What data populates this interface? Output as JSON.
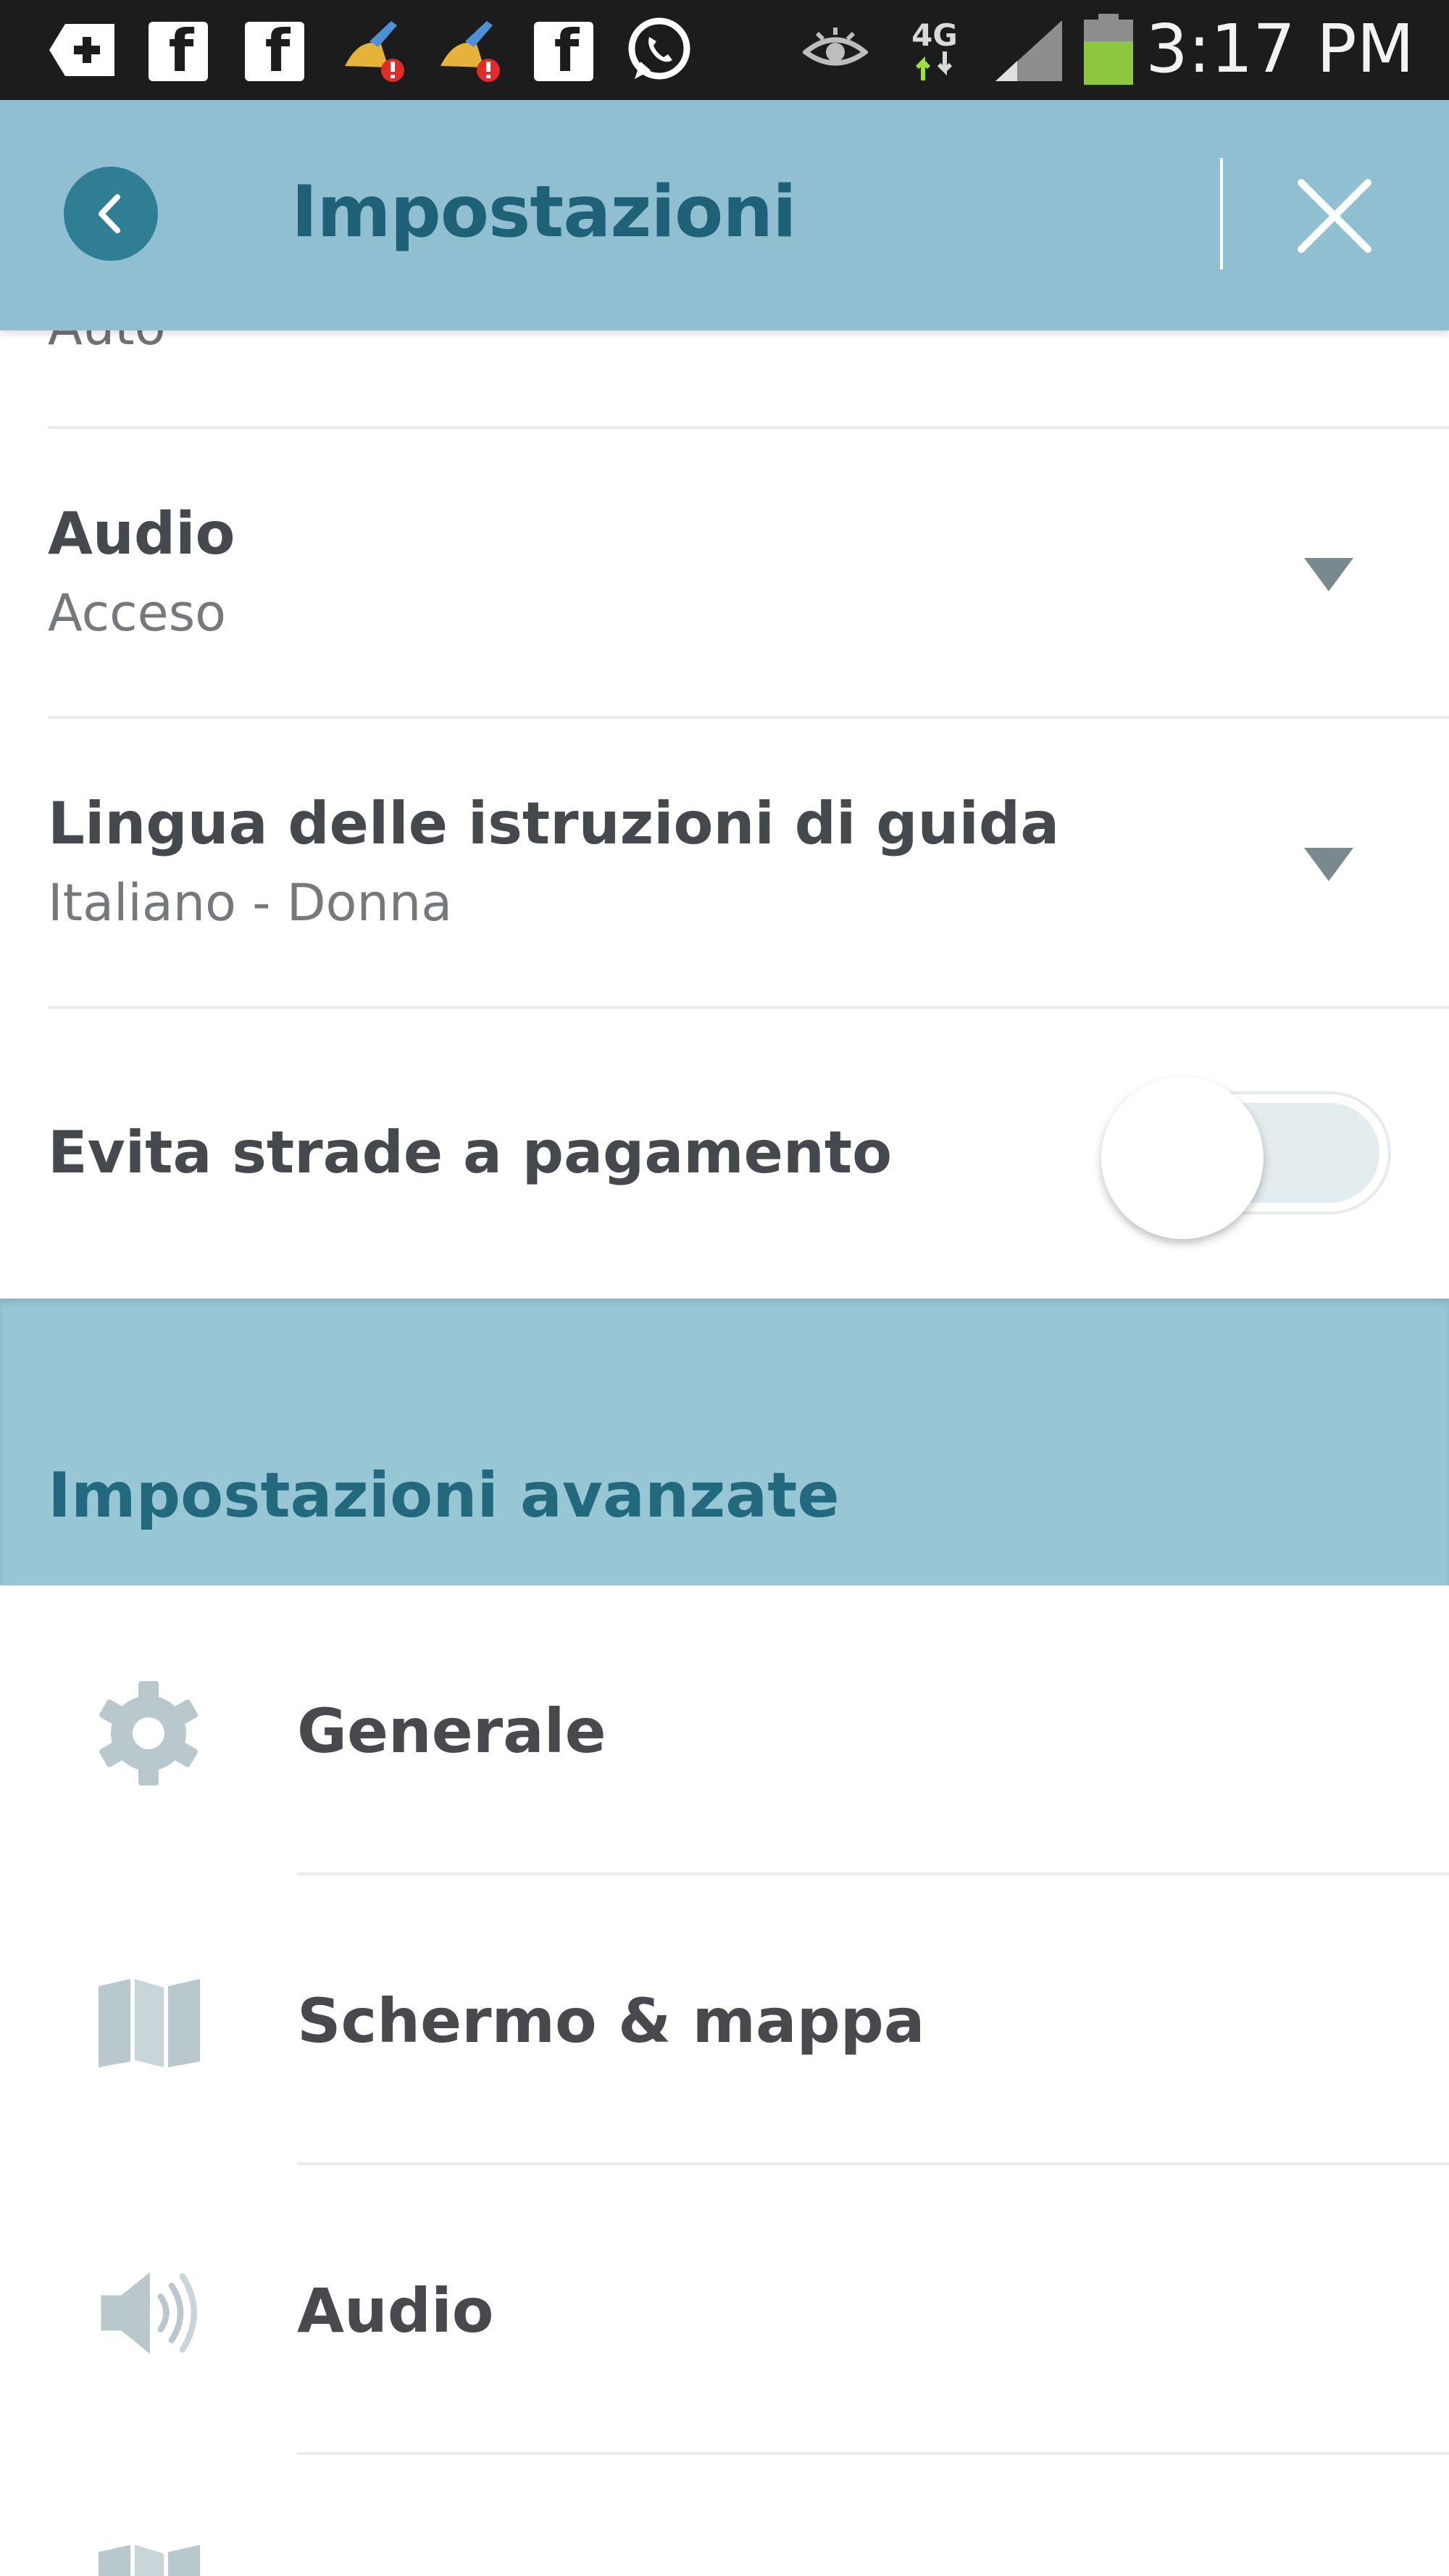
{
  "status_bar": {
    "time": "3:17 PM",
    "network": "4G",
    "icons": [
      "add-icon",
      "facebook-icon",
      "facebook-icon",
      "cleaner-icon",
      "cleaner-icon",
      "facebook-icon",
      "whatsapp-icon",
      "eye-icon",
      "network-4g-icon",
      "signal-icon",
      "battery-icon"
    ]
  },
  "header": {
    "title": "Impostazioni",
    "back_icon": "back-arrow-icon",
    "close_icon": "close-icon"
  },
  "settings": {
    "partial_value": "Auto",
    "audio": {
      "title": "Audio",
      "value": "Acceso"
    },
    "language": {
      "title": "Lingua delle istruzioni di guida",
      "value": "Italiano - Donna"
    },
    "toll_roads": {
      "title": "Evita strade a pagamento",
      "enabled": false
    }
  },
  "advanced": {
    "title": "Impostazioni avanzate",
    "items": [
      {
        "label": "Generale",
        "icon": "gear-icon"
      },
      {
        "label": "Schermo & mappa",
        "icon": "map-icon"
      },
      {
        "label": "Audio",
        "icon": "speaker-icon"
      },
      {
        "label": "",
        "icon": "map-icon"
      }
    ]
  },
  "colors": {
    "header_bg": "#8fbfd0",
    "accent": "#2f7e93",
    "title_text": "#1f6277",
    "section_bg": "#97c6d4"
  }
}
